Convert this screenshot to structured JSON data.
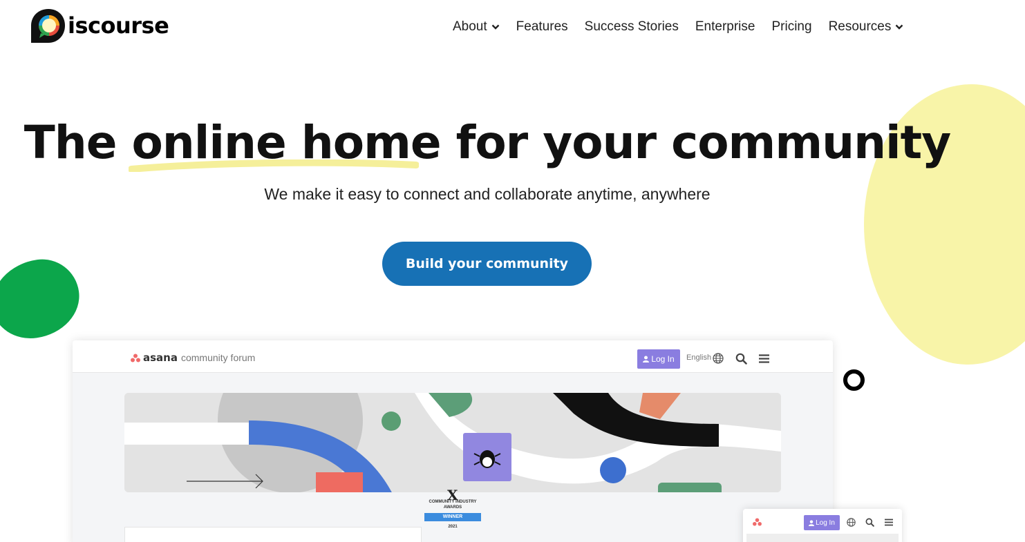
{
  "brand": {
    "logo_text": "iscourse"
  },
  "nav": {
    "items": [
      {
        "label": "About",
        "has_dropdown": true
      },
      {
        "label": "Features",
        "has_dropdown": false
      },
      {
        "label": "Success Stories",
        "has_dropdown": false
      },
      {
        "label": "Enterprise",
        "has_dropdown": false
      },
      {
        "label": "Pricing",
        "has_dropdown": false
      },
      {
        "label": "Resources",
        "has_dropdown": true
      }
    ]
  },
  "hero": {
    "title_start": "The ",
    "title_highlight": "online home",
    "title_end": " for your community",
    "subtitle": "We make it easy to connect and collaborate anytime, anywhere",
    "cta_label": "Build your community"
  },
  "preview": {
    "site_name": "asana",
    "site_suffix": "community forum",
    "login_label": "Log In",
    "language": "English",
    "award": {
      "logo": "X",
      "title": "COMMUNITY INDUSTRY AWARDS",
      "ribbon": "WINNER",
      "year": "2021"
    },
    "mobile_login_label": "Log In"
  },
  "colors": {
    "accent": "#1771b5",
    "yellow_blob": "#f8f4a8",
    "green_blob": "#0ca64b",
    "login_purple": "#8a7de0",
    "highlight_yellow": "#f5ef9a"
  },
  "icons": [
    "chevron-down-icon",
    "user-icon",
    "globe-icon",
    "search-icon",
    "hamburger-icon",
    "asana-dots-icon",
    "bug-icon"
  ]
}
